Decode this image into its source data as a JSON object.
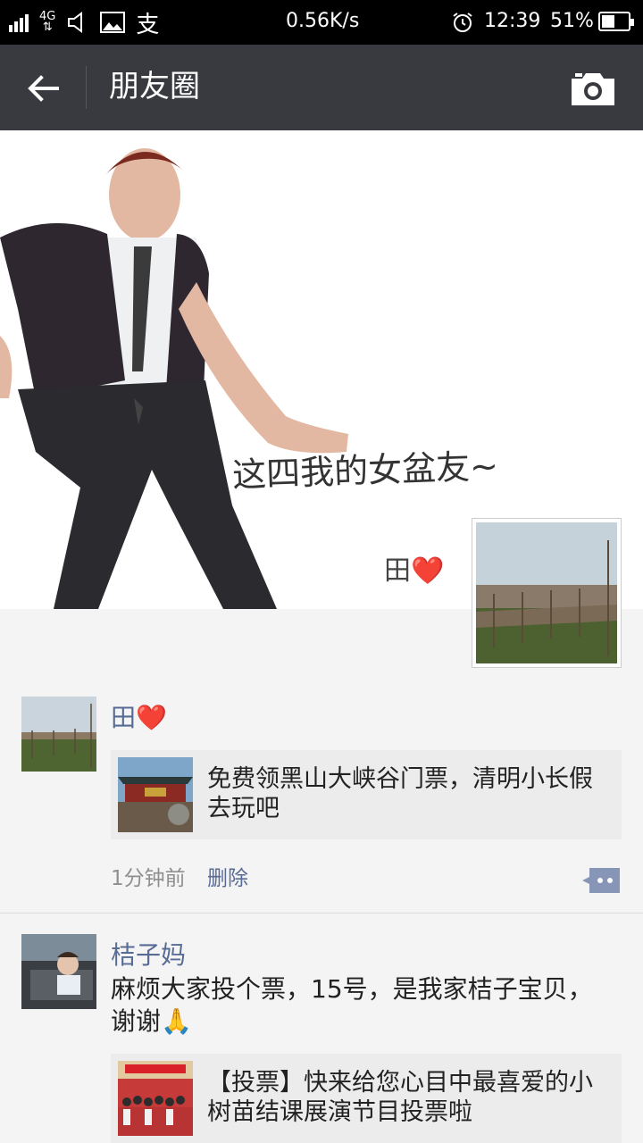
{
  "status_bar": {
    "network_type": "4G",
    "speed": "0.56K/s",
    "time": "12:39",
    "battery_percent": "51%",
    "battery_level": 0.51,
    "app_glyph": "支"
  },
  "header": {
    "title": "朋友圈",
    "back_icon": "back-arrow-icon",
    "camera_icon": "camera-icon"
  },
  "cover": {
    "caption": "这四我的女盆友~"
  },
  "profile": {
    "name": "田❤️"
  },
  "posts": [
    {
      "username": "田❤️",
      "link_title": "免费领黑山大峡谷门票，清明小长假去玩吧",
      "time": "1分钟前",
      "delete_label": "删除"
    },
    {
      "username": "桔子妈",
      "text": "麻烦大家投个票，15号，是我家桔子宝贝，谢谢🙏",
      "link_title": "【投票】快来给您心目中最喜爱的小树苗结课展演节目投票啦"
    }
  ]
}
